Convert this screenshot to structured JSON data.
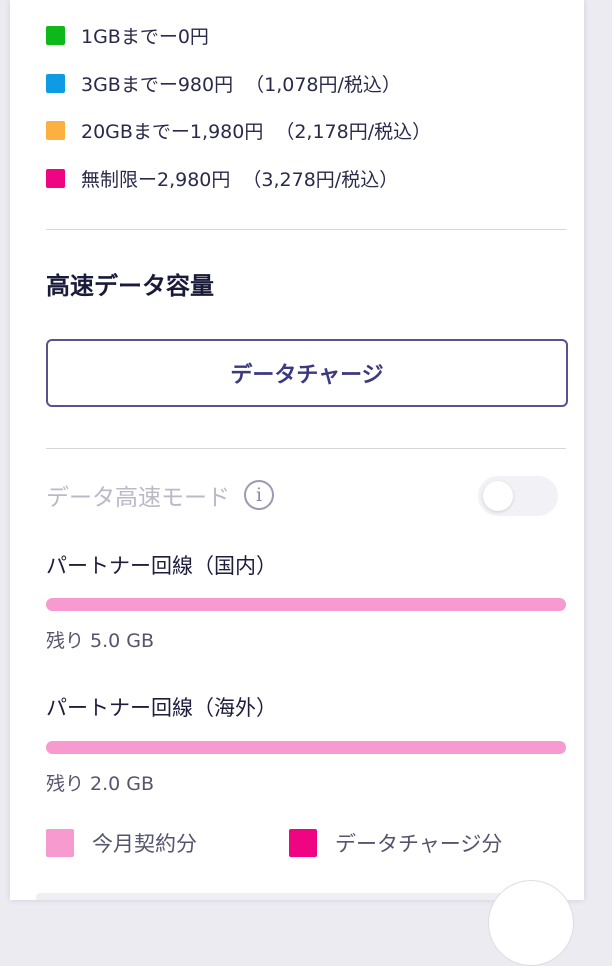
{
  "price_legend": [
    {
      "label": "1GBまでー0円",
      "tax": "",
      "color": "#0fb81a"
    },
    {
      "label": "3GBまでー980円",
      "tax": "（1,078円/税込）",
      "color": "#0e9be3"
    },
    {
      "label": "20GBまでー1,980円",
      "tax": "（2,178円/税込）",
      "color": "#fbb040"
    },
    {
      "label": "無制限ー2,980円",
      "tax": "（3,278円/税込）",
      "color": "#ef0481"
    }
  ],
  "section_title": "高速データ容量",
  "charge_button": "データチャージ",
  "high_speed_mode": {
    "label": "データ高速モード",
    "info_glyph": "i",
    "enabled": false
  },
  "lines": [
    {
      "title": "パートナー回線（国内）",
      "remaining": "残り 5.0 GB",
      "fill_fraction": 1.0
    },
    {
      "title": "パートナー回線（海外）",
      "remaining": "残り 2.0 GB",
      "fill_fraction": 1.0
    }
  ],
  "usage_legend": [
    {
      "label": "今月契約分",
      "color": "#f79ad0"
    },
    {
      "label": "データチャージ分",
      "color": "#ef0481"
    }
  ]
}
